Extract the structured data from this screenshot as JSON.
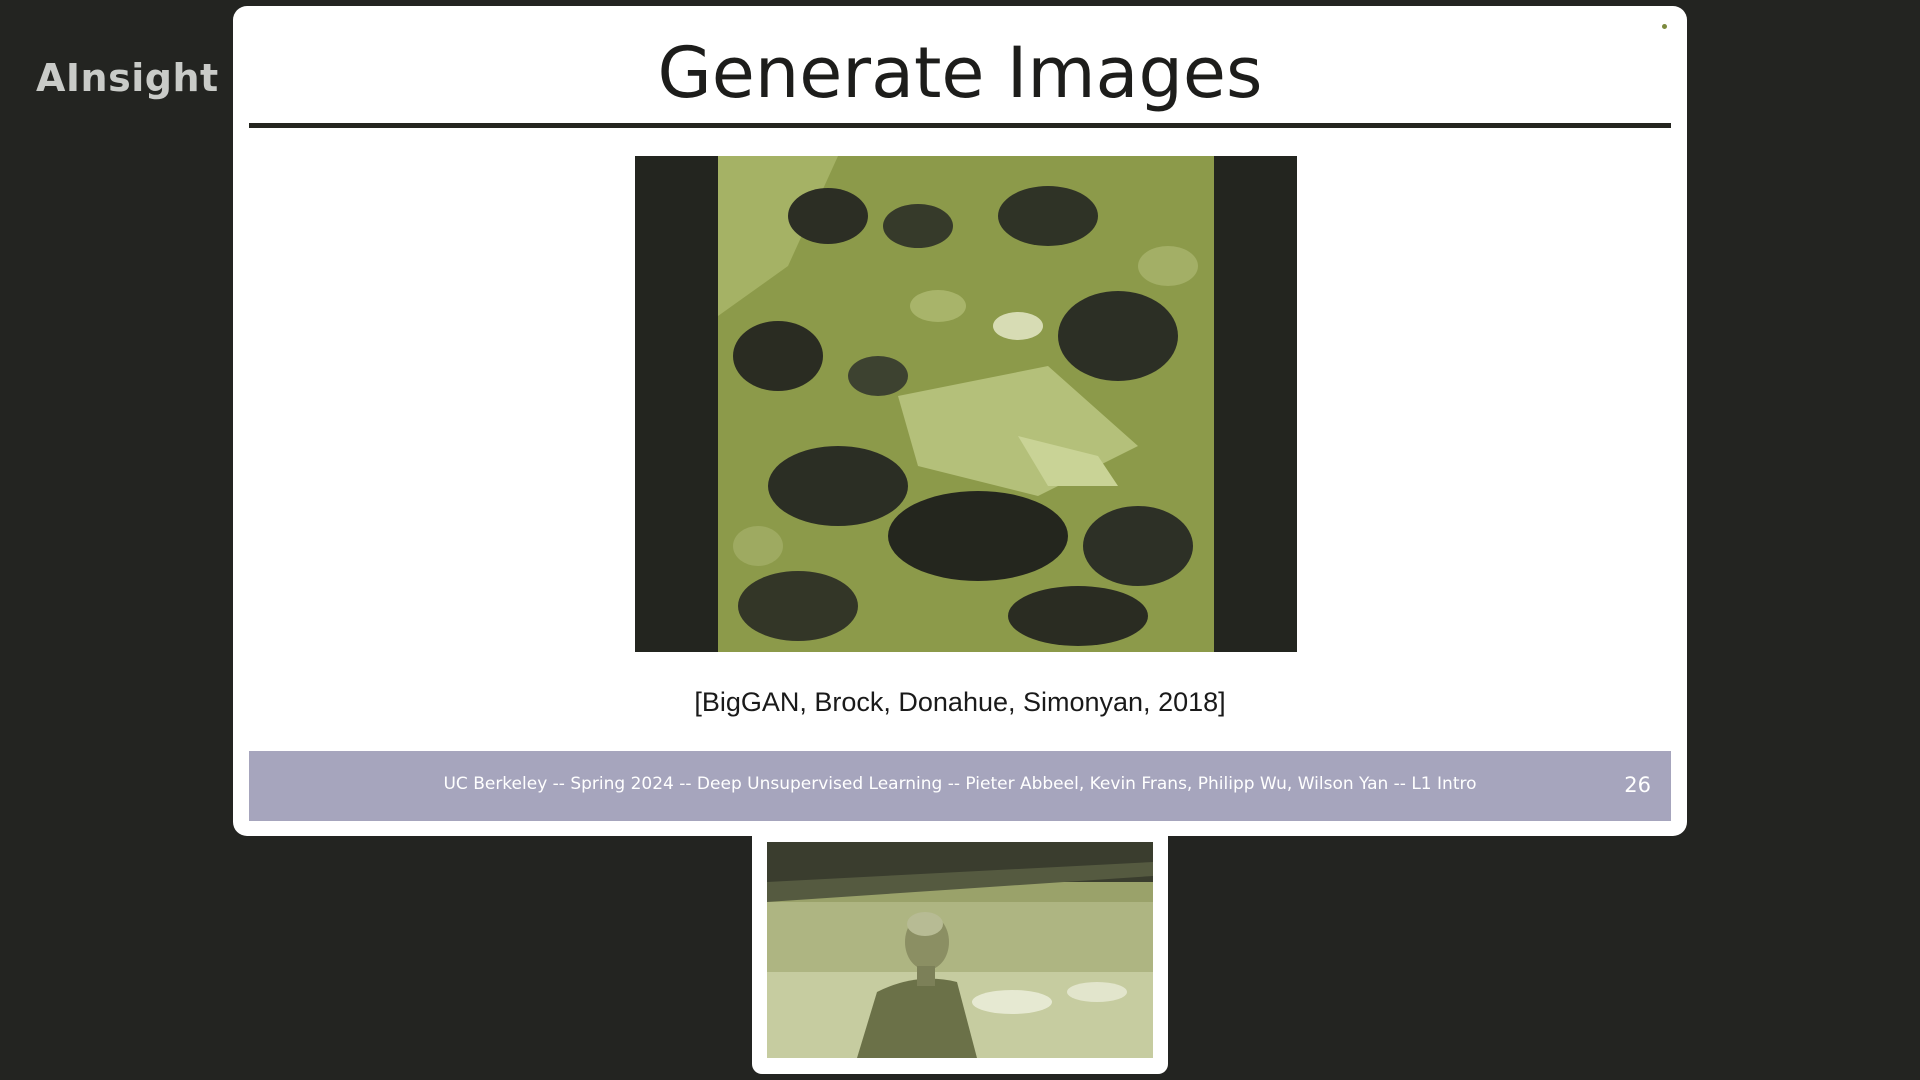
{
  "brand": {
    "name": "AInsight",
    "mark_icon": "brand-wordmark-icon"
  },
  "slide": {
    "title": "Generate Images",
    "media": {
      "kind": "video",
      "icon": "generated-image-video"
    },
    "citation": "[BigGAN, Brock, Donahue, Simonyan, 2018]",
    "footer": {
      "text": "UC Berkeley -- Spring 2024 -- Deep Unsupervised Learning -- Pieter Abbeel, Kevin Frans, Philipp Wu, Wilson Yan -- L1 Intro",
      "page_number": "26"
    }
  },
  "camera": {
    "icon": "speaker-camera-feed"
  },
  "colors": {
    "background": "#232421",
    "slide": "#ffffff",
    "title_rule": "#24251f",
    "footer_band": "#a6a5bd",
    "image_tint": "#8c9a4a"
  }
}
